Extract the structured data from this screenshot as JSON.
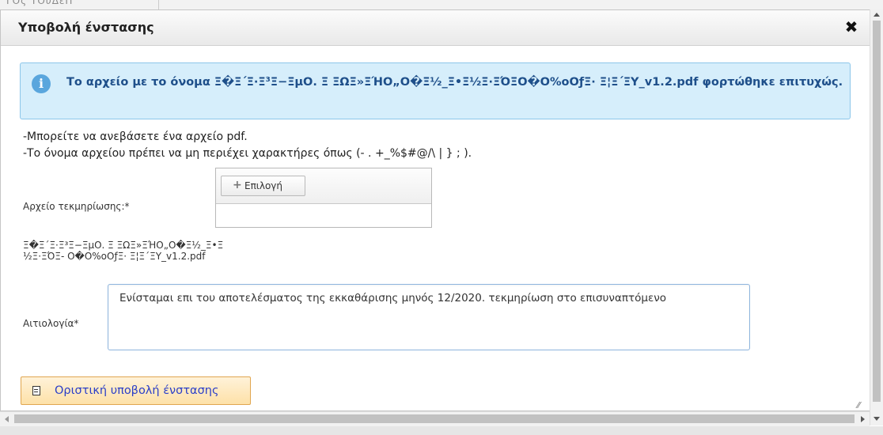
{
  "background": {
    "tab_text": "ΓΟς ΤΟυΔεΠ"
  },
  "dialog": {
    "title": "Υποβολή ένστασης",
    "close_label": "✖"
  },
  "alert": {
    "icon": "info-icon",
    "message": "Το αρχείο με το όνομα Ξ�Ξ΄Ξ·Ξ³Ξ−ΞμΟ. Ξ ΞΩΞ»ΞΉΟ„Ο�Ξ½_Ξ•Ξ½Ξ·ΞΌΞΟ�Ο%oΟƒΞ· Ξ¦Ξ΄ΞΥ_v1.2.pdf φορτώθηκε επιτυχώς."
  },
  "instructions": {
    "line1": "-Μπορείτε να ανεβάσετε ένα αρχείο pdf.",
    "line2": "-Το όνομα αρχείου πρέπει να μη περιέχει χαρακτήρες όπως (- . +_%$#@/\\ | } ; )."
  },
  "file_field": {
    "label": "Αρχείο τεκμηρίωσης:*",
    "choose_label": "Επιλογή",
    "uploaded_filename": "Ξ�Ξ΄Ξ·Ξ³Ξ−ΞμΟ. Ξ ΞΩΞ»ΞΉΟ„Ο�Ξ½_Ξ•Ξ½Ξ·ΞΌΞ- Ο�Ο%oΟƒΞ· Ξ¦Ξ΄ΞΥ_v1.2.pdf"
  },
  "reason_field": {
    "label": "Αιτιολογία*",
    "value": "Ενίσταμαι επι του αποτελέσματος της εκκαθάρισης μηνός 12/2020. τεκμηρίωση στο επισυναπτόμενο"
  },
  "submit": {
    "label": "Οριστική υποβολή ένστασης"
  },
  "colors": {
    "alert_bg": "#d6eefb",
    "alert_text": "#1e4f8a",
    "submit_bg": "#fde1a8",
    "submit_text": "#2a3ec8"
  }
}
